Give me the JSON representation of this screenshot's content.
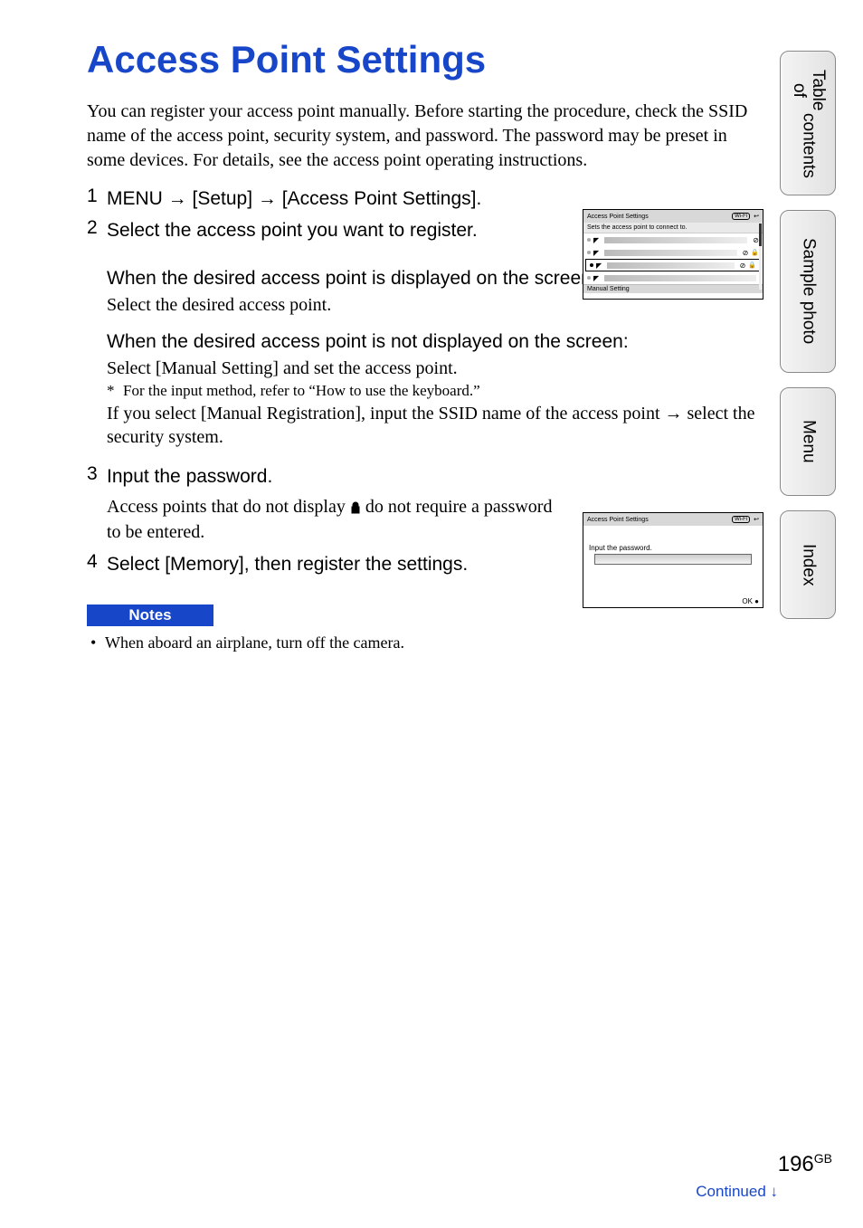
{
  "title": "Access Point Settings",
  "intro": "You can register your access point manually.\nBefore starting the procedure, check the SSID name of the access point, security system, and password. The password may be preset in some devices. For details, see the access point operating instructions.",
  "steps": {
    "s1": {
      "num": "1",
      "part1": "MENU ",
      "part2": " [Setup] ",
      "part3": " [Access Point Settings]."
    },
    "s2": {
      "num": "2",
      "text": "Select the access point you want to register."
    },
    "sub1": {
      "head": "When the desired access point is displayed on the screen:",
      "body": "Select the desired access point."
    },
    "sub2": {
      "head": "When the desired access point is not displayed on the screen:",
      "body1": "Select [Manual Setting] and set the access point.",
      "note_ast": "*",
      "note": "For the input method, refer to “How to use the keyboard.”",
      "body2a": "If you select [Manual Registration], input the SSID name of the access point ",
      "body2b": " select the security system."
    },
    "s3": {
      "num": "3",
      "text": "Input the password.",
      "body_a": "Access points that do not display ",
      "body_b": " do not require a password to be entered."
    },
    "s4": {
      "num": "4",
      "text": "Select [Memory], then register the settings."
    }
  },
  "notes": {
    "label": "Notes",
    "items": [
      "When aboard an airplane, turn off the camera."
    ]
  },
  "fig1": {
    "title": "Access Point Settings",
    "wifi": "Wi-Fi",
    "sub": "Sets the access point to connect to.",
    "manual": "Manual Setting"
  },
  "fig2": {
    "title": "Access Point Settings",
    "wifi": "Wi-Fi",
    "label": "Input the password.",
    "ok": "OK"
  },
  "tabs": {
    "toc_a": "Table of",
    "toc_b": "contents",
    "sample": "Sample photo",
    "menu": "Menu",
    "index": "Index"
  },
  "footer": {
    "page": "196",
    "gb": "GB",
    "continued": "Continued ↓"
  },
  "glyphs": {
    "arrow": "→",
    "back": "↩",
    "dot": "•",
    "nolock": "⊘",
    "lock": "🔒",
    "signal": "◤"
  }
}
